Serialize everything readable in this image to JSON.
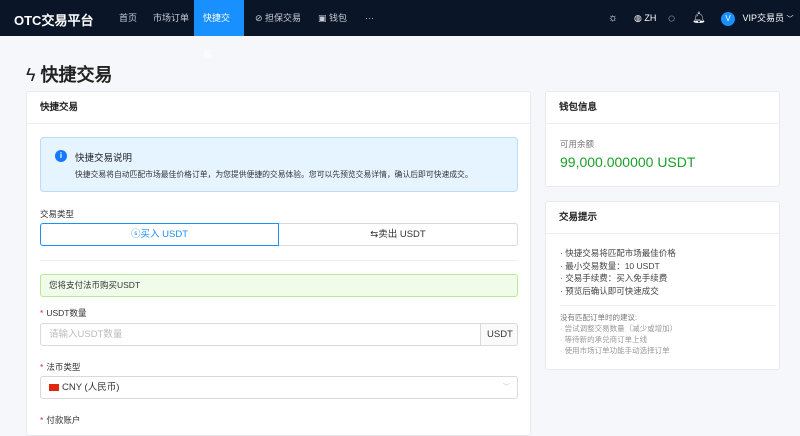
{
  "nav": {
    "logo": "OTC交易平台",
    "items": [
      "首页",
      "市场订单",
      "快捷交易",
      "担保交易",
      "钱包",
      "···"
    ],
    "lang": "ZH",
    "avatar": "V",
    "user": "VIP交易员"
  },
  "page": {
    "title": "快捷交易"
  },
  "trade": {
    "header": "快捷交易",
    "info_title": "快捷交易说明",
    "info_text": "快捷交易将自动匹配市场最佳价格订单，为您提供便捷的交易体验。您可以先预览交易详情，确认后即可快速成交。",
    "type_label": "交易类型",
    "buy": "买入 USDT",
    "sell": "卖出 USDT",
    "notice": "您将支付法币购买USDT",
    "amount_label": "USDT数量",
    "amount_placeholder": "请输入USDT数量",
    "amount_unit": "USDT",
    "fiat_label": "法币类型",
    "fiat_value": "CNY (人民币)",
    "account_label": "付款账户"
  },
  "wallet": {
    "header": "钱包信息",
    "balance_label": "可用余额",
    "balance": "99,000.000000 USDT"
  },
  "tips": {
    "header": "交易提示",
    "items": [
      "快捷交易将匹配市场最佳价格",
      "最小交易数量：10 USDT",
      "交易手续费：买入免手续费",
      "预览后确认即可快速成交"
    ],
    "suggest_title": "没有匹配订单时的建议:",
    "suggestions": [
      "尝试调整交易数量（减少或增加）",
      "等待新的承兑商订单上线",
      "使用市场订单功能手动选择订单"
    ]
  },
  "colors": {
    "accent": "#1890ff",
    "balance": "#1a9f29",
    "nav": "#0a1528"
  }
}
